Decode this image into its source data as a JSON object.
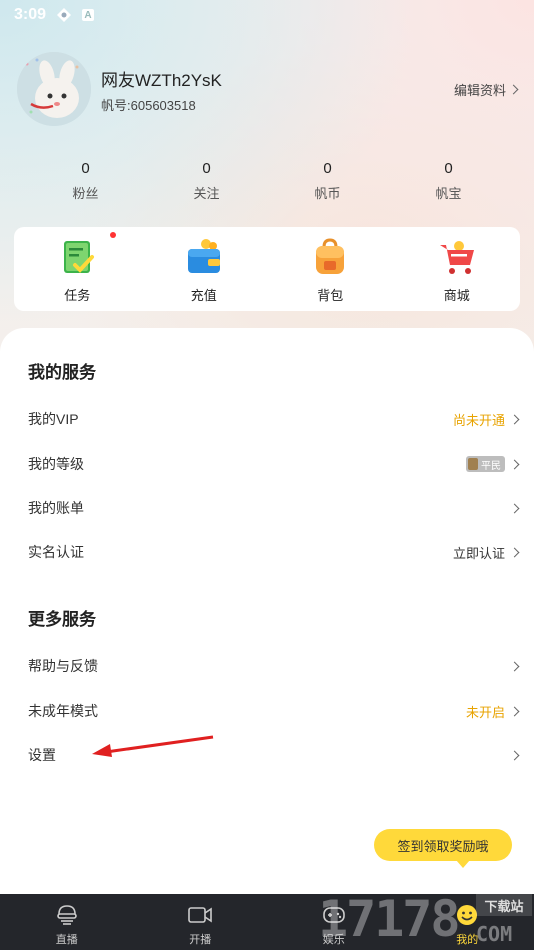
{
  "status_bar": {
    "time": "3:09"
  },
  "profile": {
    "username": "网友WZTh2YsK",
    "account_label": "帆号:",
    "account_number": "605603518",
    "edit_label": "编辑资料"
  },
  "stats": [
    {
      "value": "0",
      "label": "粉丝"
    },
    {
      "value": "0",
      "label": "关注"
    },
    {
      "value": "0",
      "label": "帆币"
    },
    {
      "value": "0",
      "label": "帆宝"
    }
  ],
  "quick_actions": [
    {
      "label": "任务",
      "icon": "task-icon"
    },
    {
      "label": "充值",
      "icon": "wallet-icon"
    },
    {
      "label": "背包",
      "icon": "backpack-icon"
    },
    {
      "label": "商城",
      "icon": "cart-icon"
    }
  ],
  "my_services": {
    "title": "我的服务",
    "rows": [
      {
        "label": "我的VIP",
        "value": "尚未开通"
      },
      {
        "label": "我的等级",
        "value": "平民"
      },
      {
        "label": "我的账单",
        "value": ""
      },
      {
        "label": "实名认证",
        "value": "立即认证"
      }
    ]
  },
  "more_services": {
    "title": "更多服务",
    "rows": [
      {
        "label": "帮助与反馈",
        "value": ""
      },
      {
        "label": "未成年模式",
        "value": "未开启"
      },
      {
        "label": "设置",
        "value": ""
      }
    ]
  },
  "tooltip": "签到领取奖励哦",
  "bottom_nav": [
    {
      "label": "直播",
      "icon": "live-icon"
    },
    {
      "label": "开播",
      "icon": "camera-icon"
    },
    {
      "label": "娱乐",
      "icon": "gamepad-icon"
    },
    {
      "label": "我的",
      "icon": "smiley-icon"
    }
  ],
  "watermark": {
    "number": "17178",
    "site": "下载站",
    "domain": "COM"
  },
  "colors": {
    "accent_yellow": "#ffd93a",
    "value_yellow": "#e8a300",
    "nav_bg": "#24262b",
    "annotation_arrow": "#e02020"
  }
}
